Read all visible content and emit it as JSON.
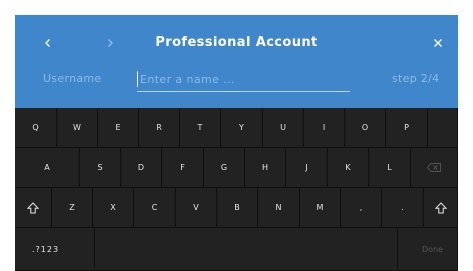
{
  "header": {
    "title": "Professional Account",
    "back_icon": "chevron-left-icon",
    "forward_icon": "chevron-right-icon",
    "close_icon": "close-icon",
    "color": "#3f86cb"
  },
  "form": {
    "field_label": "Username",
    "input_placeholder": "Enter a name ...",
    "input_value": "",
    "step": "step 2/4"
  },
  "keyboard": {
    "row1": [
      "Q",
      "W",
      "E",
      "R",
      "T",
      "Y",
      "U",
      "I",
      "O",
      "P"
    ],
    "row2": [
      "A",
      "S",
      "D",
      "F",
      "G",
      "H",
      "J",
      "K",
      "L"
    ],
    "row3": [
      "Z",
      "X",
      "C",
      "V",
      "B",
      "N",
      "M",
      ",",
      "."
    ],
    "shift_icon": "shift-icon",
    "backspace_icon": "backspace-icon",
    "numbers_label": ".?123",
    "done_label": "Done"
  }
}
